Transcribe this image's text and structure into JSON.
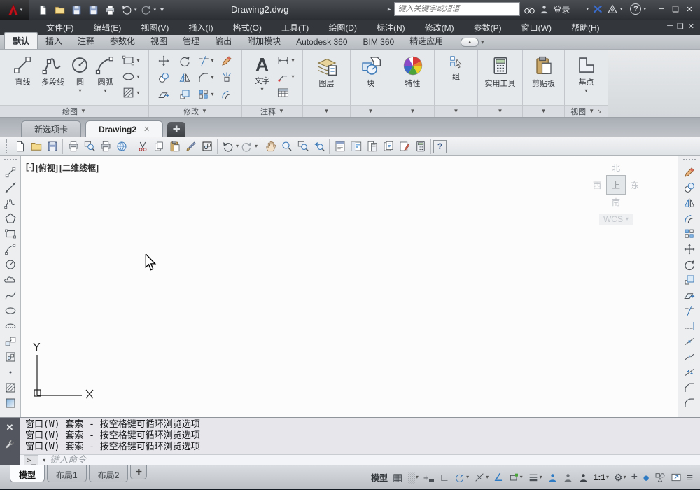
{
  "titlebar": {
    "title": "Drawing2.dwg",
    "search_placeholder": "键入关键字或短语",
    "signin": "登录"
  },
  "menubar": {
    "items": [
      "文件(F)",
      "编辑(E)",
      "视图(V)",
      "插入(I)",
      "格式(O)",
      "工具(T)",
      "绘图(D)",
      "标注(N)",
      "修改(M)",
      "参数(P)",
      "窗口(W)",
      "帮助(H)"
    ]
  },
  "ribbon": {
    "tabs": [
      "默认",
      "插入",
      "注释",
      "参数化",
      "视图",
      "管理",
      "输出",
      "附加模块",
      "Autodesk 360",
      "BIM 360",
      "精选应用"
    ],
    "active_tab": "默认",
    "draw_panel": {
      "title": "绘图",
      "line": "直线",
      "polyline": "多段线",
      "circle": "圆",
      "arc": "圆弧"
    },
    "modify_panel": {
      "title": "修改"
    },
    "annotate_panel": {
      "title": "注释",
      "text": "文字"
    },
    "layers_panel": {
      "label": "图层"
    },
    "block_panel": {
      "label": "块"
    },
    "properties_panel": {
      "label": "特性"
    },
    "groups_panel": {
      "label": "组"
    },
    "utilities_panel": {
      "label": "实用工具"
    },
    "clipboard_panel": {
      "label": "剪贴板"
    },
    "view_panel": {
      "title": "视图",
      "base": "基点"
    }
  },
  "file_tabs": {
    "new_tab": "新选项卡",
    "drawing_tab": "Drawing2"
  },
  "viewport": {
    "minus": "[-]",
    "view": "[俯视]",
    "visual_style": "[二维线框]"
  },
  "viewcube": {
    "north": "北",
    "west": "西",
    "top": "上",
    "east": "东",
    "south": "南",
    "wcs": "WCS"
  },
  "command": {
    "history": [
      "窗口(W) 套索 - 按空格键可循环浏览选项",
      "窗口(W) 套索 - 按空格键可循环浏览选项",
      "窗口(W) 套索 - 按空格键可循环浏览选项"
    ],
    "prompt": ">_",
    "placeholder": "键入命令"
  },
  "layout_tabs": {
    "model": "模型",
    "layout1": "布局1",
    "layout2": "布局2"
  },
  "statusbar": {
    "model": "模型",
    "scale": "1:1"
  },
  "icons": {
    "grid": "▦",
    "snap": "░",
    "infer": "+",
    "ortho": "∟",
    "osnap3d": "∠",
    "lineweight": "≡",
    "gear": "⚙",
    "plus": "+",
    "hardware": "●",
    "customization": "≡",
    "minimize": "─",
    "maximize": "❑",
    "close": "✕",
    "restore": "❏"
  }
}
